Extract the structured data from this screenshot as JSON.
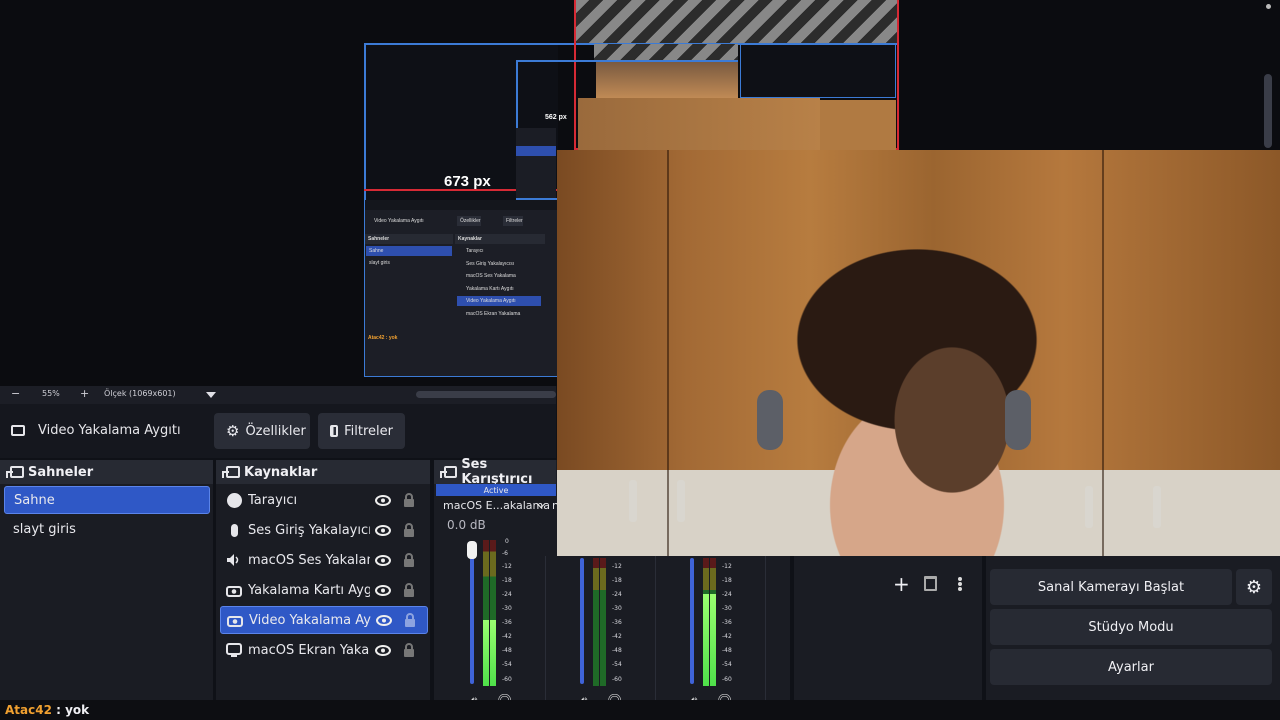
{
  "preview": {
    "width_label_large": "673 px",
    "width_label_small": "562 px",
    "mini_obs": {
      "header_small": "Video Yakalama Aygıtı",
      "properties_small": "Özellikler",
      "filters_small": "Filtreler",
      "scenes_title_small": "Sahneler",
      "sources_title_small": "Kaynaklar",
      "scenes_small": [
        "Sahne",
        "slayt giris"
      ],
      "sources_small": [
        "Tarayıcı",
        "Ses Giriş Yakalayıcısı",
        "macOS Ses Yakalama",
        "Yakalama Kartı Aygıtı",
        "Video Yakalama Aygıtı",
        "macOS Ekran Yakalama"
      ],
      "status_small": "Atac42 : yok"
    }
  },
  "zoom": {
    "minus": "−",
    "percent": "55%",
    "plus": "+",
    "scale_label": "Ölçek (1069x601)"
  },
  "properties_bar": {
    "source_name": "Video Yakalama Aygıtı",
    "properties_button": "Özellikler",
    "filters_button": "Filtreler"
  },
  "scenes": {
    "title": "Sahneler",
    "items": [
      {
        "label": "Sahne",
        "active": true
      },
      {
        "label": "slayt giris",
        "active": false
      }
    ]
  },
  "sources": {
    "title": "Kaynaklar",
    "items": [
      {
        "label": "Tarayıcı",
        "icon": "globe-icon"
      },
      {
        "label": "Ses Giriş Yakalayıcısı",
        "icon": "microphone-icon"
      },
      {
        "label": "macOS Ses Yakalama",
        "icon": "speaker-icon"
      },
      {
        "label": "Yakalama Kartı Aygıtı",
        "icon": "camera-icon"
      },
      {
        "label": "Video Yakalama Aygıtı",
        "icon": "camera-icon",
        "active": true
      },
      {
        "label": "macOS Ekran Yakalama",
        "icon": "monitor-icon"
      }
    ]
  },
  "mixer": {
    "title": "Ses Karıştırıcı",
    "active_tab": "Active",
    "channel_name": "macOS E...akalama",
    "second_channel_initial": "n",
    "db_value": "0.0 dB",
    "scale": [
      "0",
      "-6",
      "-12",
      "-18",
      "-24",
      "-30",
      "-36",
      "-42",
      "-48",
      "-54",
      "-60"
    ],
    "channels": [
      {
        "level": 0.45
      },
      {
        "level": 0.0
      },
      {
        "level": 0.72
      }
    ]
  },
  "controls": {
    "virtual_camera": "Sanal Kamerayı Başlat",
    "studio_mode": "Stüdyo Modu",
    "settings": "Ayarlar"
  },
  "status": {
    "user": "Atac42",
    "message": " : yok"
  },
  "colors": {
    "accent_blue": "#2f58c6",
    "selection_red": "#d62a35",
    "selection_blue": "#3c7bd6",
    "username_orange": "#f0a030"
  }
}
